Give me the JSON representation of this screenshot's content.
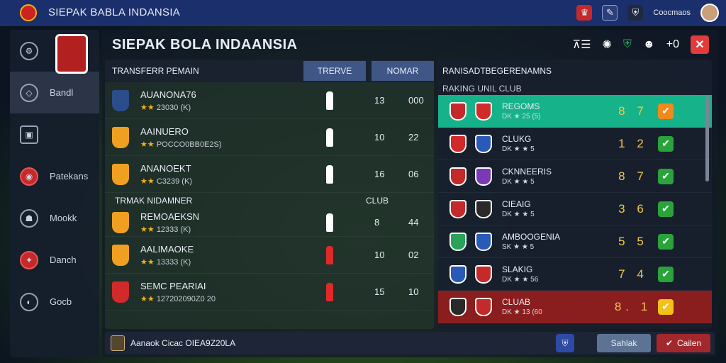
{
  "topbar": {
    "title": "SIEPAK BABLA INDANSIA",
    "user_label": "Coocmaos",
    "icons": [
      "trophy-icon",
      "edit-icon",
      "shield-icon"
    ]
  },
  "header": {
    "title": "SIEPAK BOLA INDAANSIA",
    "value": "+0",
    "icons": [
      "formation-icon",
      "gear-icon",
      "club-badge-icon",
      "player-icon"
    ]
  },
  "sidebar": {
    "items": [
      {
        "label": "",
        "icon": "stats-icon"
      },
      {
        "label": "Bandl",
        "icon": "ball-icon"
      },
      {
        "label": "",
        "icon": "trophy-icon"
      },
      {
        "label": "Patekans",
        "icon": "team-icon"
      },
      {
        "label": "Mookk",
        "icon": "transfer-icon"
      },
      {
        "label": "Danch",
        "icon": "match-icon"
      },
      {
        "label": "Gocb",
        "icon": "settings-icon"
      }
    ]
  },
  "transfer": {
    "title": "TRANSFERR PEMAIN",
    "tabs": [
      "TRERVE",
      "NOMAR"
    ],
    "section_label": "TRMAK NIDAMNER",
    "section_col": "CLUB",
    "rows": [
      {
        "name": "AUANONA76",
        "stat": "23030 (K)",
        "n1": "13",
        "n2": "000",
        "shield": "#2b4d8a",
        "fig": "#ffffff",
        "section": false
      },
      {
        "name": "AAINUERO",
        "stat": "POCCO0BB0E2S)",
        "n1": "10",
        "n2": "22",
        "shield": "#f0a020",
        "fig": "#ffffff",
        "section": false
      },
      {
        "name": "ANANOEKT",
        "stat": "C3239 (K)",
        "n1": "16",
        "n2": "06",
        "shield": "#f0a020",
        "fig": "#ffffff",
        "section": false
      },
      {
        "name": "REMOAEKSN",
        "stat": "12333 (K)",
        "n1": "8",
        "n2": "44",
        "shield": "#f0a020",
        "fig": "#ffffff",
        "section": true
      },
      {
        "name": "AALIMAOKE",
        "stat": "13333 (K)",
        "n1": "10",
        "n2": "02",
        "shield": "#f0a020",
        "fig": "#e02a2a",
        "section": false
      },
      {
        "name": "SEMC PEARIAI",
        "stat": "127202090Z0 20",
        "n1": "15",
        "n2": "10",
        "shield": "#d02a2a",
        "fig": "#e02a2a",
        "section": false
      }
    ]
  },
  "ranking": {
    "title": "RANISADTBEGERENAMNS",
    "subtitle": "RAKING UNIL CLUB",
    "rows": [
      {
        "name": "REGOMS",
        "stat": "DK ★ 25 (5)",
        "score": "8 7",
        "badge_a": "#c42a2a",
        "badge_b": "#d12a2a",
        "check": "orange",
        "highlight": "hl"
      },
      {
        "name": "CLUKG",
        "stat": "DK ★ ★ 5",
        "score": "1 2",
        "badge_a": "#d12a2a",
        "badge_b": "#2a5ab8",
        "check": "green",
        "highlight": ""
      },
      {
        "name": "CKNNEERIS",
        "stat": "DK ★ ★ 5",
        "score": "8 7",
        "badge_a": "#c42a2a",
        "badge_b": "#7a3ab8",
        "check": "green",
        "highlight": ""
      },
      {
        "name": "CIEAIG",
        "stat": "DK ★ ★ 5",
        "score": "3 6",
        "badge_a": "#c42a2a",
        "badge_b": "#2a2a2a",
        "check": "green",
        "highlight": ""
      },
      {
        "name": "AMBOOGENIA",
        "stat": "SK ★ ★ 5",
        "score": "5 5",
        "badge_a": "#2aa35a",
        "badge_b": "#2a5ab8",
        "check": "green",
        "highlight": ""
      },
      {
        "name": "SLAKIG",
        "stat": "DK ★ ★ 56",
        "score": "7 4",
        "badge_a": "#2a5ab8",
        "badge_b": "#c42a2a",
        "check": "green",
        "highlight": ""
      },
      {
        "name": "CLUAB",
        "stat": "DK ★ 13 (60",
        "score": "8. 1",
        "badge_a": "#2a2a2a",
        "badge_b": "#c42a2a",
        "check": "yellow",
        "highlight": "hl2"
      }
    ]
  },
  "footer": {
    "text": "Aanaok Cicac OIEA9Z20LA",
    "save_label": "Sahlak",
    "cancel_label": "Cailen"
  }
}
